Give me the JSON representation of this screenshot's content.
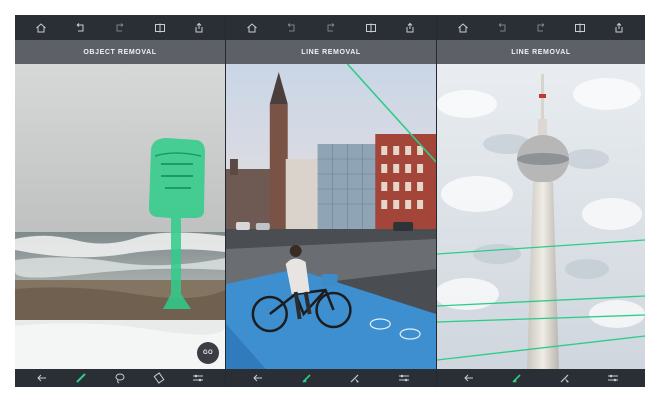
{
  "panels": [
    {
      "title": "OBJECT REMOVAL",
      "go_label": "GO",
      "top_icons": [
        "home-icon",
        "undo-icon",
        "redo-icon",
        "compare-icon",
        "share-icon"
      ],
      "bottom_icons": [
        "back-arrow-icon",
        "brush-icon",
        "lasso-icon",
        "eraser-icon",
        "settings-sliders-icon"
      ]
    },
    {
      "title": "LINE REMOVAL",
      "top_icons": [
        "home-icon",
        "undo-icon",
        "redo-icon",
        "compare-icon",
        "share-icon"
      ],
      "bottom_icons": [
        "back-arrow-icon",
        "line-brush-icon",
        "line-select-icon",
        "settings-sliders-icon"
      ]
    },
    {
      "title": "LINE REMOVAL",
      "top_icons": [
        "home-icon",
        "undo-icon",
        "redo-icon",
        "compare-icon",
        "share-icon"
      ],
      "bottom_icons": [
        "back-arrow-icon",
        "line-brush-icon",
        "line-select-icon",
        "settings-sliders-icon"
      ]
    }
  ],
  "colors": {
    "app_background": "#26292f",
    "toolbar": "#2a2e35",
    "title_bar": "#5d6066",
    "selection_green": "#2ecc8a",
    "icon_default": "#c9ccd1"
  }
}
